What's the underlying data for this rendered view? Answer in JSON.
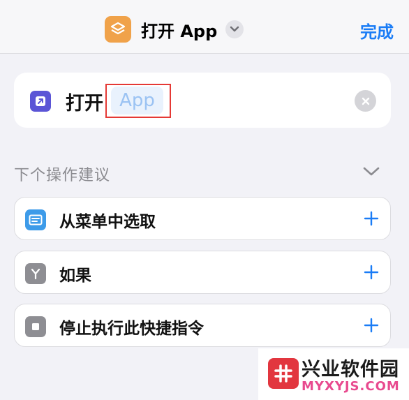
{
  "header": {
    "title": "打开 App",
    "done_label": "完成",
    "app_icon": "shortcuts-icon",
    "menu_icon": "chevron-down-icon"
  },
  "action": {
    "verb": "打开",
    "parameter_placeholder": "App",
    "icon": "open-app-icon",
    "clear_icon": "clear-icon"
  },
  "suggestions": {
    "header": "下个操作建议",
    "items": [
      {
        "label": "从菜单中选取",
        "icon": "menu-icon",
        "icon_color": "#3d9be9"
      },
      {
        "label": "如果",
        "icon": "branch-icon",
        "icon_color": "#8e8e93"
      },
      {
        "label": "停止执行此快捷指令",
        "icon": "stop-icon",
        "icon_color": "#8e8e93"
      }
    ]
  },
  "watermark": {
    "title": "兴业软件园",
    "url": "MYXYJS.COM"
  },
  "colors": {
    "accent": "#1a7cf6",
    "highlight": "#e53935",
    "app_icon": "#f0a24a",
    "open_icon": "#5b55d6"
  }
}
